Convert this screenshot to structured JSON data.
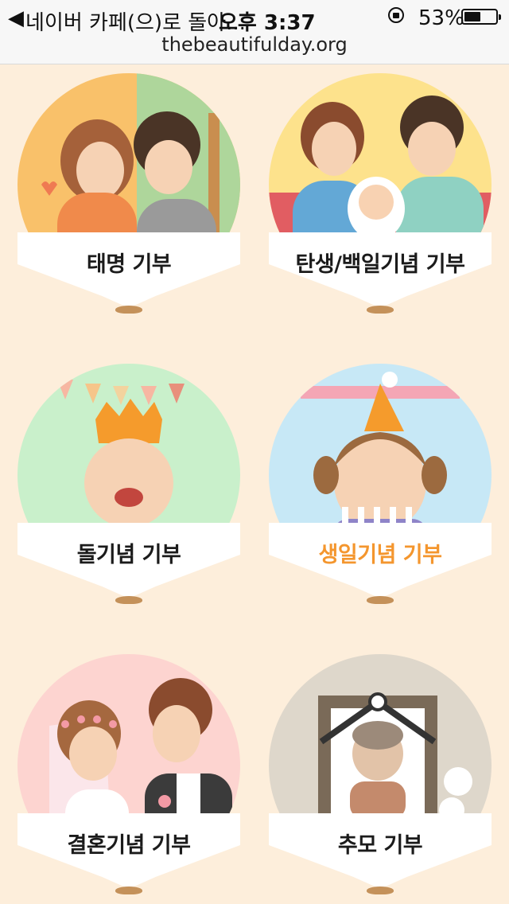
{
  "status_bar": {
    "back_label": "네이버 카페(으)로 돌아...",
    "time": "오후 3:37",
    "battery_text": "53%",
    "battery_level": 0.53,
    "url": "thebeautifulday.org"
  },
  "items": [
    {
      "label": "태명 기부",
      "bg": "#f9c16a"
    },
    {
      "label": "탄생/백일기념 기부",
      "bg": "#fde28c"
    },
    {
      "label": "돌기념 기부",
      "bg": "#c9f0cb"
    },
    {
      "label": "생일기념 기부",
      "bg": "#c7e8f6",
      "active_color": "#f4962e"
    },
    {
      "label": "결혼기념 기부",
      "bg": "#fdd4d0"
    },
    {
      "label": "추모 기부",
      "bg": "#ded7cb"
    }
  ]
}
